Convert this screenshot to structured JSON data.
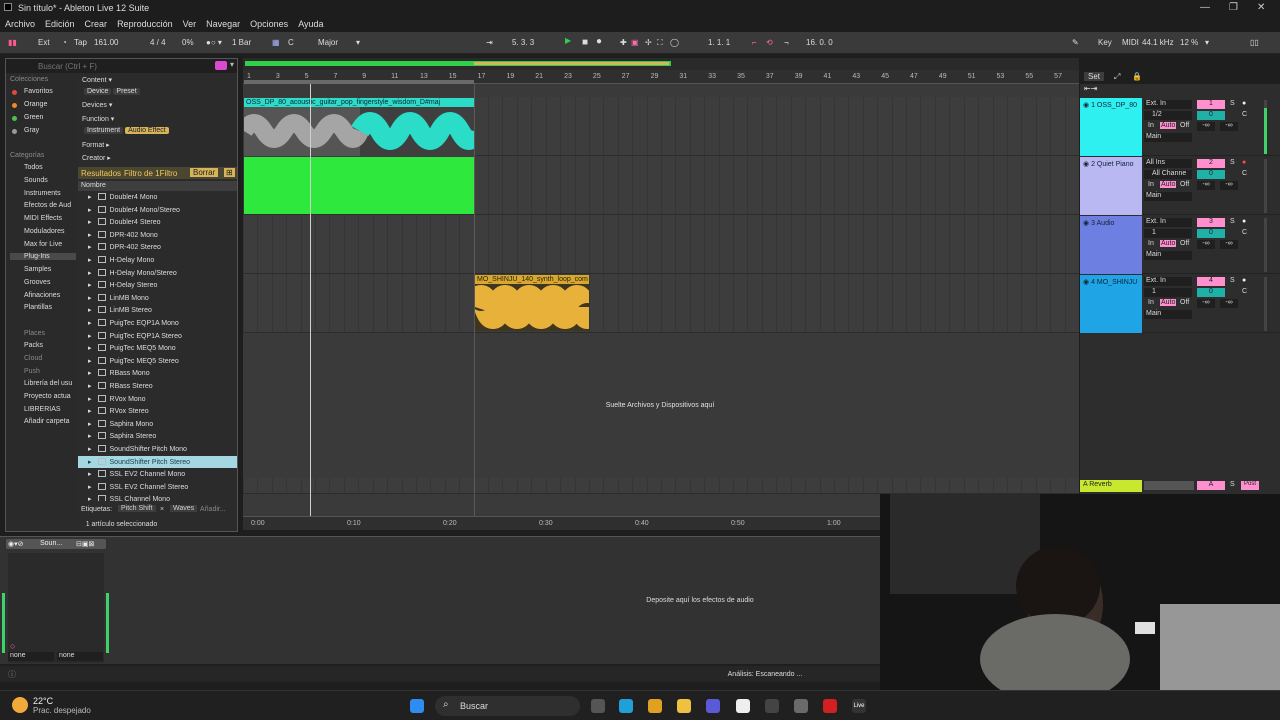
{
  "window": {
    "title": "Sin título* - Ableton Live 12 Suite"
  },
  "menu": [
    "Archivo",
    "Edición",
    "Crear",
    "Reproducción",
    "Ver",
    "Navegar",
    "Opciones",
    "Ayuda"
  ],
  "control": {
    "ext": "Ext",
    "tap": "Tap",
    "tempo": "161.00",
    "meter": "4 / 4",
    "swing": "0%",
    "quant": "1 Bar",
    "key": "C",
    "scale": "Major",
    "position": "5. 3. 3",
    "loop_start": "1. 1. 1",
    "loop_len": "16. 0. 0",
    "key_btn": "Key",
    "midi_btn": "MIDI",
    "sample_rate": "44.1 kHz",
    "cpu": "12 %"
  },
  "browser": {
    "search_placeholder": "Buscar (Ctrl + F)",
    "collections_label": "Colecciones",
    "collections": [
      {
        "name": "Favoritos",
        "color": "#e04a3a"
      },
      {
        "name": "Orange",
        "color": "#f08a24"
      },
      {
        "name": "Green",
        "color": "#4ec24e"
      },
      {
        "name": "Gray",
        "color": "#9a9a9a"
      }
    ],
    "categories_label": "Categorías",
    "categories": [
      "Todos",
      "Sounds",
      "Instruments",
      "Efectos de Aud",
      "MIDI Effects",
      "Moduladores",
      "Max for Live",
      "Plug-Ins",
      "Samples",
      "Grooves",
      "Afinaciones",
      "Plantillas"
    ],
    "places_label": "Places",
    "places": [
      "Packs",
      "Cloud",
      "Push",
      "Librería del usu",
      "Proyecto actua",
      "LIBRERIAS",
      "Añadir carpeta"
    ],
    "filters": {
      "content": "Content",
      "device": "Device",
      "preset": "Preset",
      "devices": "Devices",
      "function": "Function",
      "instrument": "Instrument",
      "audio_effect": "Audio Effect",
      "format": "Format",
      "creator": "Creator"
    },
    "results": "Resultados",
    "filter_count": "Filtro de 1Filtro",
    "clear": "Borrar",
    "name_col": "Nombre",
    "items": [
      "Doubler4 Mono",
      "Doubler4 Mono/Stereo",
      "Doubler4 Stereo",
      "DPR-402 Mono",
      "DPR-402 Stereo",
      "H-Delay Mono",
      "H-Delay Mono/Stereo",
      "H-Delay Stereo",
      "LinMB Mono",
      "LinMB Stereo",
      "PuigTec EQP1A Mono",
      "PuigTec EQP1A Stereo",
      "PuigTec MEQ5 Mono",
      "PuigTec MEQ5 Stereo",
      "RBass Mono",
      "RBass Stereo",
      "RVox Mono",
      "RVox Stereo",
      "Saphira Mono",
      "Saphira Stereo",
      "SoundShifter Pitch Mono",
      "SoundShifter Pitch Stereo",
      "SSL EV2 Channel Mono",
      "SSL EV2 Channel Stereo",
      "SSL Channel Mono"
    ],
    "tags_label": "Etiquetas:",
    "tag1": "Pitch Shift",
    "tag2": "Waves",
    "tag3": "Añadir...",
    "status": "1 artículo seleccionado"
  },
  "arrangement": {
    "bars": [
      "1",
      "3",
      "5",
      "7",
      "9",
      "11",
      "13",
      "15",
      "17",
      "19",
      "21",
      "23",
      "25",
      "27",
      "29",
      "31",
      "33",
      "35",
      "37",
      "39",
      "41",
      "43",
      "45",
      "47",
      "49",
      "51",
      "53",
      "55",
      "57"
    ],
    "times": [
      "0:00",
      "0:10",
      "0:20",
      "0:30",
      "0:40",
      "0:50",
      "1:00"
    ],
    "clip1": "OSS_DP_80_acoustic_guitar_pop_fingerstyle_wisdom_D#maj",
    "clip3": "MO_SHINJU_140_synth_loop_com",
    "drop_text": "Suelte Archivos y Dispositivos aquí"
  },
  "tracks": [
    {
      "name": "1 OSS_DP_80",
      "color": "#2ef0f0",
      "input": "Ext. In",
      "ch": "1/2",
      "num": "1",
      "mon": "Auto"
    },
    {
      "name": "2 Quiet Piano",
      "color": "#b9b8f2",
      "input": "All Ins",
      "ch": "All Channe",
      "num": "2",
      "mon": "Auto"
    },
    {
      "name": "3 Audio",
      "color": "#6d7fe0",
      "input": "Ext. In",
      "ch": "1",
      "num": "3",
      "mon": "Auto"
    },
    {
      "name": "4 MO_SHINJU",
      "color": "#1fa5e6",
      "input": "Ext. In",
      "ch": "1",
      "num": "4",
      "mon": "Auto"
    }
  ],
  "return_track": {
    "name": "A Reverb",
    "letter": "A",
    "post": "Post"
  },
  "mixer_labels": {
    "set": "Set",
    "in": "In",
    "off": "Off",
    "main": "Main",
    "vol": "0",
    "pan": "C",
    "inf": "-∞",
    "s": "S"
  },
  "detail": {
    "device_name": "Soun...",
    "drop_text": "Deposite aquí los efectos de audio",
    "sel1": "none",
    "sel2": "none"
  },
  "status": {
    "analysis": "Análisis: Escaneando ..."
  },
  "taskbar": {
    "temp": "22°C",
    "weather": "Prac. despejado",
    "search": "Buscar"
  }
}
